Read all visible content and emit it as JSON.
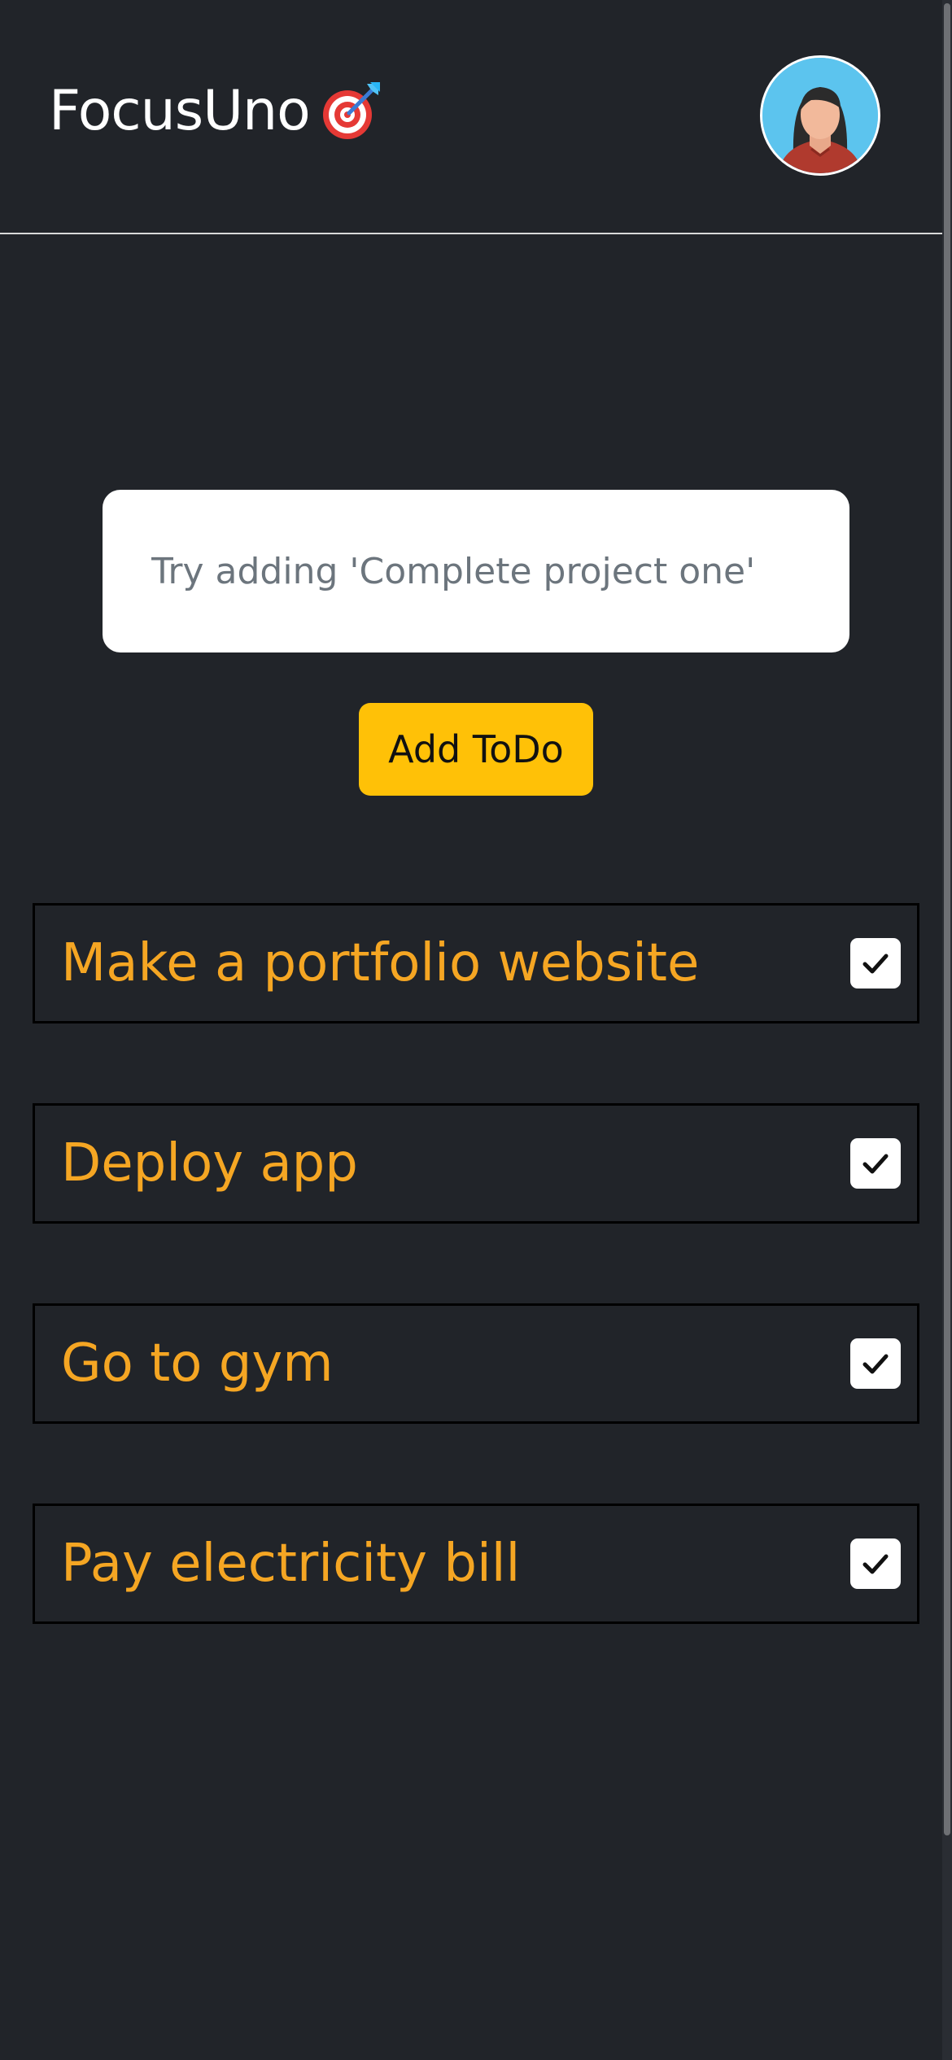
{
  "header": {
    "title": "FocusUno",
    "title_icon": "direct-hit-target-icon",
    "avatar_icon": "user-avatar"
  },
  "composer": {
    "placeholder": "Try adding 'Complete project one'",
    "value": "",
    "add_button_label": "Add ToDo"
  },
  "todos": [
    {
      "text": "Make a portfolio website",
      "checked": true
    },
    {
      "text": "Deploy app",
      "checked": true
    },
    {
      "text": "Go to gym",
      "checked": true
    },
    {
      "text": "Pay electricity bill",
      "checked": true
    }
  ],
  "colors": {
    "background": "#212429",
    "accent_button": "#ffc107",
    "todo_text": "#f5a623",
    "divider": "#d9d9d9"
  }
}
